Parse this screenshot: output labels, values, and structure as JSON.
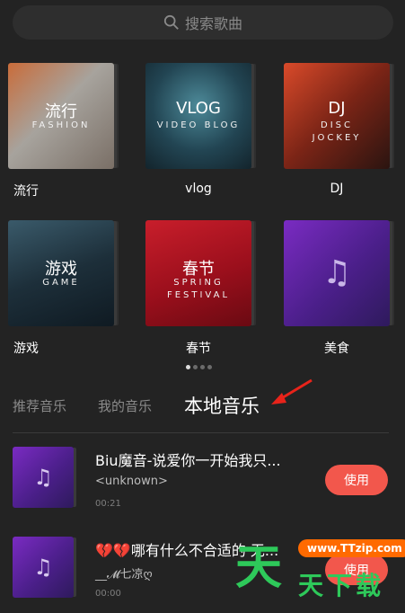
{
  "search": {
    "placeholder": "搜索歌曲"
  },
  "categories": [
    {
      "label": "流行",
      "cover_title": "流行",
      "cover_sub1": "FASHION",
      "cover_sub2": ""
    },
    {
      "label": "vlog",
      "cover_title": "VLOG",
      "cover_sub1": "VIDEO BLOG",
      "cover_sub2": ""
    },
    {
      "label": "DJ",
      "cover_title": "DJ",
      "cover_sub1": "DISC",
      "cover_sub2": "JOCKEY"
    },
    {
      "label": "游戏",
      "cover_title": "游戏",
      "cover_sub1": "GAME",
      "cover_sub2": ""
    },
    {
      "label": "春节",
      "cover_title": "春节",
      "cover_sub1": "SPRING",
      "cover_sub2": "FESTIVAL"
    },
    {
      "label": "美食",
      "cover_title": "",
      "cover_sub1": "",
      "cover_sub2": ""
    }
  ],
  "tabs": [
    {
      "label": "推荐音乐"
    },
    {
      "label": "我的音乐"
    },
    {
      "label": "本地音乐"
    }
  ],
  "songs": [
    {
      "title": "Biu魔音-说爱你一开始我只...",
      "artist": "<unknown>",
      "duration": "00:21",
      "action": "使用"
    },
    {
      "title": "💔💔哪有什么不合适的 无...",
      "artist": "__𝓜七凉ღ",
      "duration": "00:00",
      "action": "使用"
    }
  ],
  "watermark": {
    "url": "www.TTzip.com",
    "big": "天",
    "small": "天下载"
  },
  "colors": {
    "accent": "#f2574c",
    "background": "#232323",
    "watermark": "#2ec95a"
  }
}
